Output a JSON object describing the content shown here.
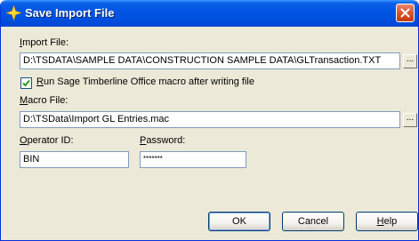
{
  "window": {
    "title": "Save Import File",
    "close_label": "Close"
  },
  "import_file": {
    "label_hotkey": "I",
    "label_rest": "mport File:",
    "value": "D:\\TSDATA\\SAMPLE DATA\\CONSTRUCTION SAMPLE DATA\\GLTransaction.TXT",
    "browse_label": "..."
  },
  "run_macro": {
    "checked": true,
    "label_hotkey": "R",
    "label_rest": "un Sage Timberline Office macro after writing file"
  },
  "macro_file": {
    "label_hotkey": "M",
    "label_rest": "acro File:",
    "value": "D:\\TSData\\Import GL Entries.mac",
    "browse_label": "..."
  },
  "operator_id": {
    "label_hotkey": "O",
    "label_rest": "perator ID:",
    "value": "BIN"
  },
  "password": {
    "label_hotkey": "P",
    "label_rest": "assword:",
    "value": "*******"
  },
  "buttons": {
    "ok": "OK",
    "cancel": "Cancel",
    "help_hotkey": "H",
    "help_rest": "elp"
  },
  "colors": {
    "titlebar": "#0054e3",
    "dialog_bg": "#ece9d8",
    "field_border": "#7f9db9",
    "close_button": "#d9562c"
  }
}
